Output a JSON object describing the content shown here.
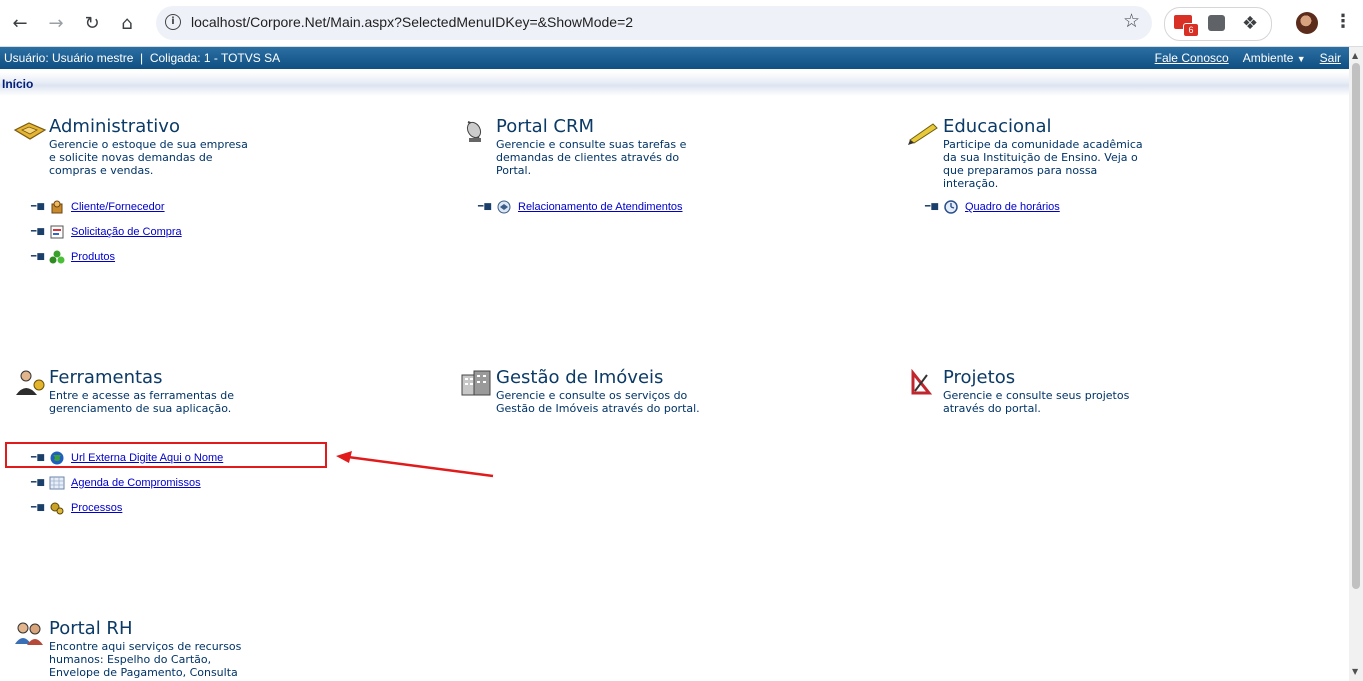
{
  "browser": {
    "url": "localhost/Corpore.Net/Main.aspx?SelectedMenuIDKey=&ShowMode=2",
    "gmail_badge": "6"
  },
  "header": {
    "user_text": "Usuário: Usuário mestre  |  Coligada: 1 - TOTVS SA",
    "contact": "Fale Conosco",
    "environment": "Ambiente",
    "logout": "Sair"
  },
  "breadcrumb": "Início",
  "modules": [
    {
      "title": "Administrativo",
      "description": "Gerencie o estoque de sua empresa e solicite novas demandas de compras e vendas.",
      "links": [
        "Cliente/Fornecedor",
        "Solicitação de Compra",
        "Produtos"
      ]
    },
    {
      "title": "Portal CRM",
      "description": "Gerencie e consulte suas tarefas e demandas de clientes através do Portal.",
      "links": [
        "Relacionamento de Atendimentos"
      ]
    },
    {
      "title": "Educacional",
      "description": "Participe da comunidade acadêmica da sua Instituição de Ensino. Veja o que preparamos para nossa interação.",
      "links": [
        "Quadro de horários"
      ]
    },
    {
      "title": "Ferramentas",
      "description": "Entre e acesse as ferramentas de gerenciamento de sua aplicação.",
      "links": [
        "Url Externa Digite Aqui o Nome",
        "Agenda de Compromissos",
        "Processos"
      ]
    },
    {
      "title": "Gestão de Imóveis",
      "description": "Gerencie e consulte os serviços do Gestão de Imóveis através do portal.",
      "links": []
    },
    {
      "title": "Projetos",
      "description": "Gerencie e consulte seus projetos através do portal.",
      "links": []
    },
    {
      "title": "Portal RH",
      "description": "Encontre aqui serviços de recursos humanos: Espelho do Cartão, Envelope de Pagamento, Consulta",
      "links": []
    }
  ],
  "colors": {
    "header_bar": "#0f4f82",
    "title": "#0b3a66",
    "link": "#0000cc",
    "annotation": "#e11b1b"
  }
}
